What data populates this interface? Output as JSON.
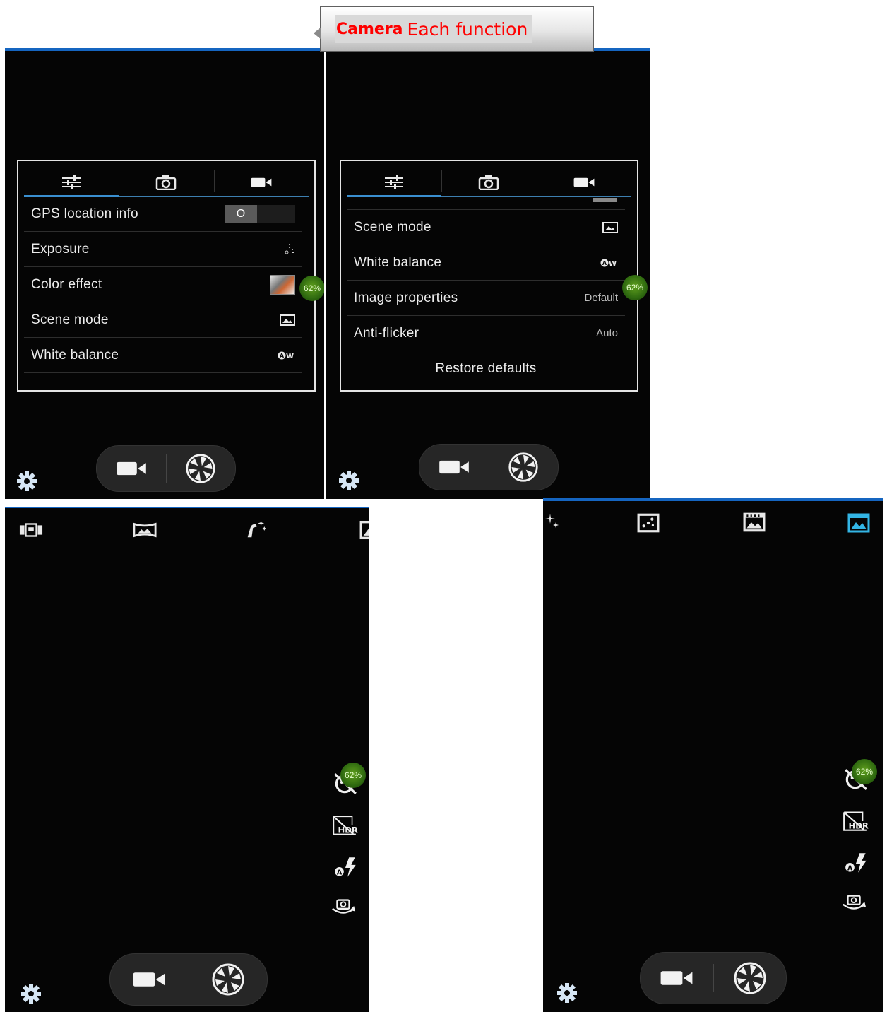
{
  "callout": {
    "bold": "Camera",
    "rest": "Each function"
  },
  "colors": {
    "accent": "#3a8fd0",
    "callout_text": "#ff0000",
    "badge": "#4f8f18",
    "panel_bg": "#050505"
  },
  "panel1": {
    "tabs": [
      {
        "icon": "sliders-icon",
        "active": true
      },
      {
        "icon": "camera-icon",
        "active": false
      },
      {
        "icon": "video-icon",
        "active": false
      }
    ],
    "gps": {
      "label": "GPS location info",
      "toggle": "O"
    },
    "exposure": {
      "label": "Exposure",
      "icon": "exposure-icon"
    },
    "color_effect": {
      "label": "Color effect",
      "icon": "color-effect-thumbnail"
    },
    "scene_mode": {
      "label": "Scene mode",
      "icon": "scene-icon"
    },
    "white_balance": {
      "label": "White balance",
      "icon": "white-balance-auto-icon"
    },
    "battery": "62%"
  },
  "panel2": {
    "tabs": [
      {
        "icon": "sliders-icon",
        "active": true
      },
      {
        "icon": "camera-icon",
        "active": false
      },
      {
        "icon": "video-icon",
        "active": false
      }
    ],
    "scene_mode": {
      "label": "Scene mode",
      "icon": "scene-icon"
    },
    "white_balance": {
      "label": "White balance",
      "icon": "white-balance-auto-icon"
    },
    "image_properties": {
      "label": "Image properties",
      "value": "Default"
    },
    "anti_flicker": {
      "label": "Anti-flicker",
      "value": "Auto"
    },
    "restore": "Restore defaults",
    "battery": "62%"
  },
  "panel3": {
    "modes": [
      "multi-angle-icon",
      "panorama-icon",
      "face-beauty-icon",
      "picture-icon"
    ],
    "side_icons": [
      "face-detect-off-icon",
      "hdr-off-icon",
      "flash-auto-icon",
      "switch-camera-icon"
    ],
    "battery": "62%"
  },
  "panel4": {
    "modes": [
      "sparkle-icon",
      "live-photo-icon",
      "motion-track-icon",
      "picture-mode-icon"
    ],
    "active_mode": "picture-mode-icon",
    "side_icons": [
      "face-detect-off-icon",
      "hdr-off-icon",
      "flash-auto-icon",
      "switch-camera-icon"
    ],
    "battery": "62%"
  },
  "controls": {
    "video_button": "video-record-icon",
    "shutter_button": "shutter-icon",
    "settings": "gear-icon"
  }
}
